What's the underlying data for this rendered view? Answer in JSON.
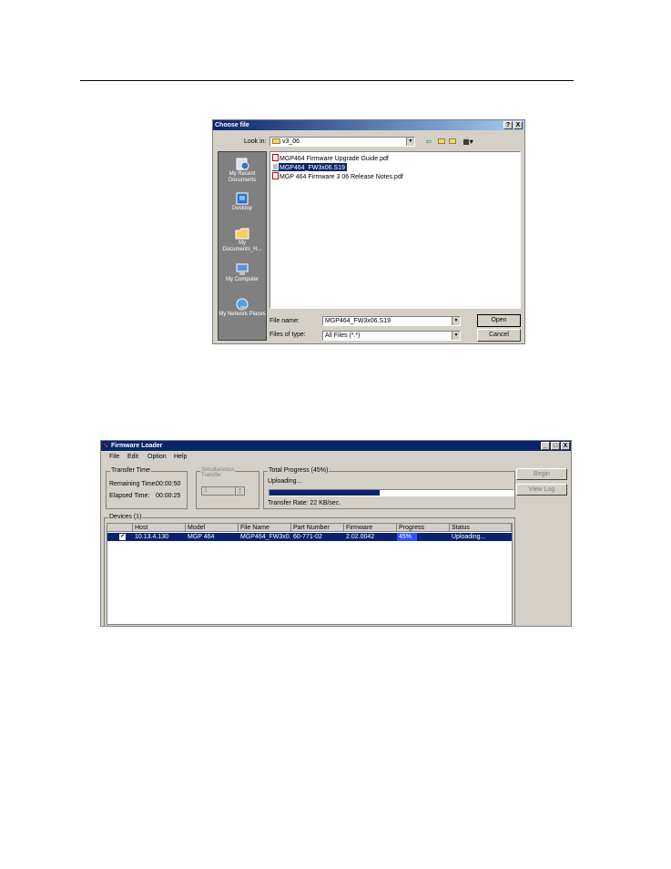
{
  "choose_file": {
    "title": "Choose file",
    "help_btn": "?",
    "close_btn": "X",
    "look_in_label": "Look in:",
    "look_in_value": "v3_06",
    "places": [
      "My Recent Documents",
      "Desktop",
      "My Documents_H...",
      "My Computer",
      "My Network Places"
    ],
    "files": [
      {
        "name": "MGP464 Firmware Upgrade Guide.pdf",
        "icon": "pdf-icon",
        "selected": false
      },
      {
        "name": "MGP464_FW3x06.S19",
        "icon": "file-icon",
        "selected": true
      },
      {
        "name": "MGP 464 Firmware 3 06 Release Notes.pdf",
        "icon": "pdf-icon",
        "selected": false
      }
    ],
    "file_name_label": "File name:",
    "file_name_value": "MGP464_FW3x06.S19",
    "file_type_label": "Files of type:",
    "file_type_value": "All Files (*.*)",
    "open_btn": "Open",
    "cancel_btn": "Cancel"
  },
  "firmware_loader": {
    "title": "Firmware Loader",
    "win_controls": [
      "_",
      "□",
      "X"
    ],
    "menu": [
      "File",
      "Edit",
      "Option",
      "Help"
    ],
    "transfer_time": {
      "legend": "Transfer Time",
      "remaining_label": "Remaining Time:",
      "remaining_value": "00:00:50",
      "elapsed_label": "Elapsed Time:",
      "elapsed_value": "00:00:25"
    },
    "simultaneous": {
      "legend_line1": "Simultaneous",
      "legend_line2": "Transfer",
      "value": "1"
    },
    "total_progress": {
      "legend": "Total Progress (45%)",
      "status": "Uploading...",
      "progress_fraction": 0.45,
      "rate": "Transfer Rate: 22 KB/sec."
    },
    "begin_btn": "Begin",
    "view_log_btn": "View Log",
    "devices_legend": "Devices (1)",
    "columns": [
      "Host",
      "Model",
      "File Name",
      "Part Number",
      "Firmware",
      "Progress",
      "Status"
    ],
    "rows": [
      {
        "checked": "✔",
        "host": "10.13.4.130",
        "model": "MGP 464",
        "file": "MGP464_FW3x0...",
        "part": "60-771-02",
        "firmware": "2.02.0042",
        "progress": "45%",
        "status": "Uploading..."
      }
    ]
  }
}
